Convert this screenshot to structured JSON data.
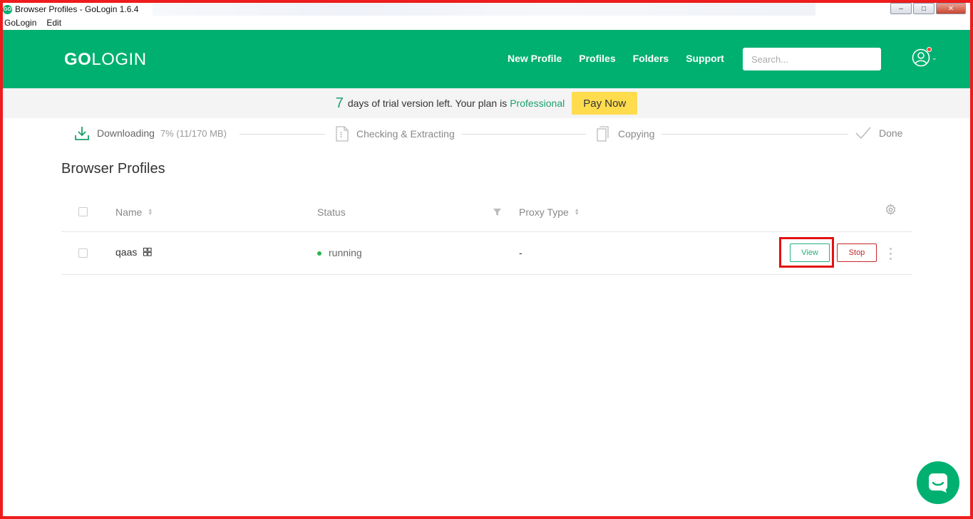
{
  "window": {
    "title": "Browser Profiles - GoLogin 1.6.4",
    "icon_text": "GO",
    "controls": [
      "minimize-icon",
      "maximize-icon",
      "close-icon"
    ]
  },
  "menu": {
    "items": [
      "GoLogin",
      "Edit"
    ]
  },
  "header": {
    "logo_go": "GO",
    "logo_rest": "LOGIN",
    "nav": [
      "New Profile",
      "Profiles",
      "Folders",
      "Support"
    ],
    "search_placeholder": "Search...",
    "avatar_icon": "user-circle-icon"
  },
  "trial": {
    "days": "7",
    "text": "days of trial version left. Your plan is",
    "plan": "Professional",
    "pay_label": "Pay Now"
  },
  "steps": {
    "downloading": {
      "label": "Downloading",
      "progress": "7% (11/170 MB)",
      "progress_fraction": 0.07
    },
    "checking": {
      "label": "Checking & Extracting"
    },
    "copying": {
      "label": "Copying"
    },
    "done": {
      "label": "Done"
    }
  },
  "page": {
    "title": "Browser Profiles"
  },
  "table": {
    "columns": {
      "name": "Name",
      "status": "Status",
      "proxy": "Proxy Type"
    },
    "rows": [
      {
        "name": "qaas",
        "os_icon": "windows-icon",
        "status": "running",
        "proxy": "-",
        "view_label": "View",
        "stop_label": "Stop"
      }
    ]
  },
  "colors": {
    "brand": "#00b071",
    "accent_yellow": "#ffdc4e",
    "stop_red": "#c62828",
    "highlight_red": "#e21212"
  }
}
